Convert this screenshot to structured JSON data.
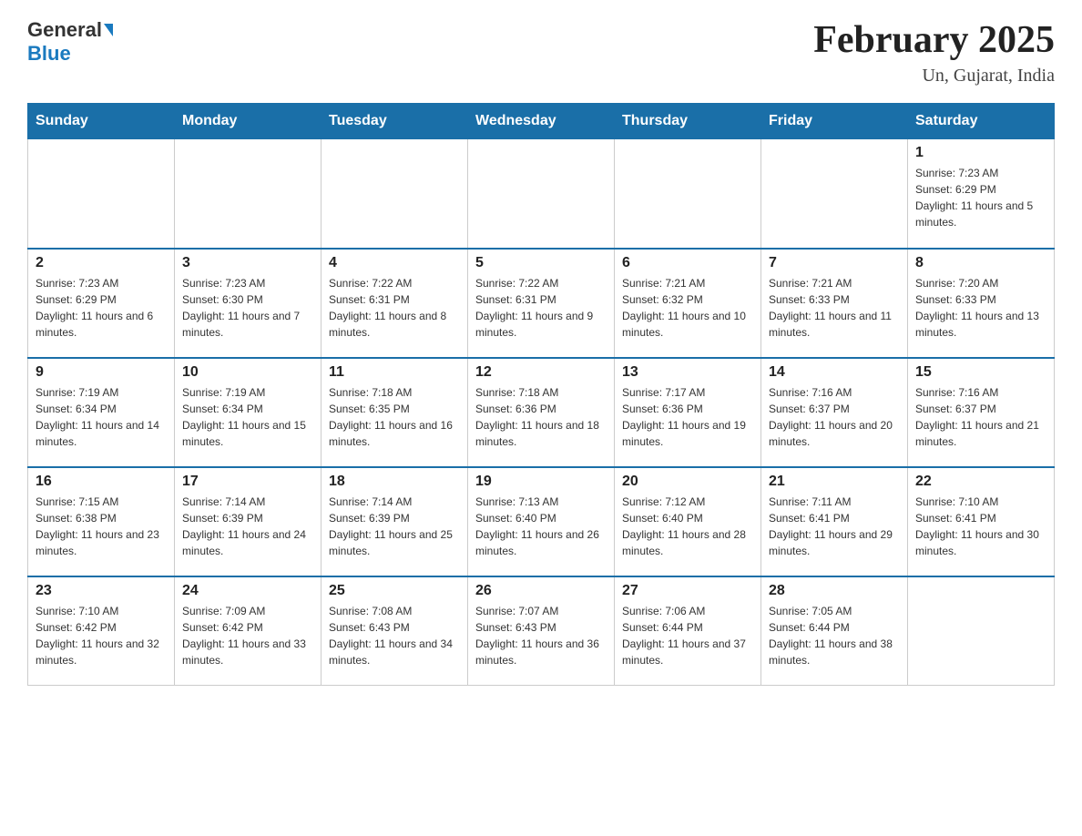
{
  "header": {
    "logo_general": "General",
    "logo_blue": "Blue",
    "month_title": "February 2025",
    "location": "Un, Gujarat, India"
  },
  "days_of_week": [
    "Sunday",
    "Monday",
    "Tuesday",
    "Wednesday",
    "Thursday",
    "Friday",
    "Saturday"
  ],
  "weeks": [
    [
      {
        "day": "",
        "info": ""
      },
      {
        "day": "",
        "info": ""
      },
      {
        "day": "",
        "info": ""
      },
      {
        "day": "",
        "info": ""
      },
      {
        "day": "",
        "info": ""
      },
      {
        "day": "",
        "info": ""
      },
      {
        "day": "1",
        "info": "Sunrise: 7:23 AM\nSunset: 6:29 PM\nDaylight: 11 hours and 5 minutes."
      }
    ],
    [
      {
        "day": "2",
        "info": "Sunrise: 7:23 AM\nSunset: 6:29 PM\nDaylight: 11 hours and 6 minutes."
      },
      {
        "day": "3",
        "info": "Sunrise: 7:23 AM\nSunset: 6:30 PM\nDaylight: 11 hours and 7 minutes."
      },
      {
        "day": "4",
        "info": "Sunrise: 7:22 AM\nSunset: 6:31 PM\nDaylight: 11 hours and 8 minutes."
      },
      {
        "day": "5",
        "info": "Sunrise: 7:22 AM\nSunset: 6:31 PM\nDaylight: 11 hours and 9 minutes."
      },
      {
        "day": "6",
        "info": "Sunrise: 7:21 AM\nSunset: 6:32 PM\nDaylight: 11 hours and 10 minutes."
      },
      {
        "day": "7",
        "info": "Sunrise: 7:21 AM\nSunset: 6:33 PM\nDaylight: 11 hours and 11 minutes."
      },
      {
        "day": "8",
        "info": "Sunrise: 7:20 AM\nSunset: 6:33 PM\nDaylight: 11 hours and 13 minutes."
      }
    ],
    [
      {
        "day": "9",
        "info": "Sunrise: 7:19 AM\nSunset: 6:34 PM\nDaylight: 11 hours and 14 minutes."
      },
      {
        "day": "10",
        "info": "Sunrise: 7:19 AM\nSunset: 6:34 PM\nDaylight: 11 hours and 15 minutes."
      },
      {
        "day": "11",
        "info": "Sunrise: 7:18 AM\nSunset: 6:35 PM\nDaylight: 11 hours and 16 minutes."
      },
      {
        "day": "12",
        "info": "Sunrise: 7:18 AM\nSunset: 6:36 PM\nDaylight: 11 hours and 18 minutes."
      },
      {
        "day": "13",
        "info": "Sunrise: 7:17 AM\nSunset: 6:36 PM\nDaylight: 11 hours and 19 minutes."
      },
      {
        "day": "14",
        "info": "Sunrise: 7:16 AM\nSunset: 6:37 PM\nDaylight: 11 hours and 20 minutes."
      },
      {
        "day": "15",
        "info": "Sunrise: 7:16 AM\nSunset: 6:37 PM\nDaylight: 11 hours and 21 minutes."
      }
    ],
    [
      {
        "day": "16",
        "info": "Sunrise: 7:15 AM\nSunset: 6:38 PM\nDaylight: 11 hours and 23 minutes."
      },
      {
        "day": "17",
        "info": "Sunrise: 7:14 AM\nSunset: 6:39 PM\nDaylight: 11 hours and 24 minutes."
      },
      {
        "day": "18",
        "info": "Sunrise: 7:14 AM\nSunset: 6:39 PM\nDaylight: 11 hours and 25 minutes."
      },
      {
        "day": "19",
        "info": "Sunrise: 7:13 AM\nSunset: 6:40 PM\nDaylight: 11 hours and 26 minutes."
      },
      {
        "day": "20",
        "info": "Sunrise: 7:12 AM\nSunset: 6:40 PM\nDaylight: 11 hours and 28 minutes."
      },
      {
        "day": "21",
        "info": "Sunrise: 7:11 AM\nSunset: 6:41 PM\nDaylight: 11 hours and 29 minutes."
      },
      {
        "day": "22",
        "info": "Sunrise: 7:10 AM\nSunset: 6:41 PM\nDaylight: 11 hours and 30 minutes."
      }
    ],
    [
      {
        "day": "23",
        "info": "Sunrise: 7:10 AM\nSunset: 6:42 PM\nDaylight: 11 hours and 32 minutes."
      },
      {
        "day": "24",
        "info": "Sunrise: 7:09 AM\nSunset: 6:42 PM\nDaylight: 11 hours and 33 minutes."
      },
      {
        "day": "25",
        "info": "Sunrise: 7:08 AM\nSunset: 6:43 PM\nDaylight: 11 hours and 34 minutes."
      },
      {
        "day": "26",
        "info": "Sunrise: 7:07 AM\nSunset: 6:43 PM\nDaylight: 11 hours and 36 minutes."
      },
      {
        "day": "27",
        "info": "Sunrise: 7:06 AM\nSunset: 6:44 PM\nDaylight: 11 hours and 37 minutes."
      },
      {
        "day": "28",
        "info": "Sunrise: 7:05 AM\nSunset: 6:44 PM\nDaylight: 11 hours and 38 minutes."
      },
      {
        "day": "",
        "info": ""
      }
    ]
  ]
}
